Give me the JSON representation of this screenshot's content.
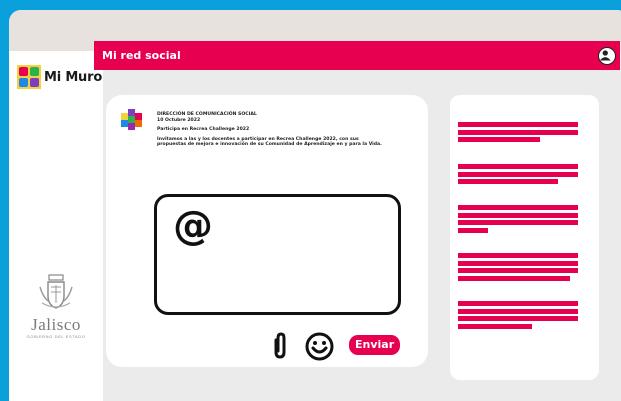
{
  "app": {
    "logo_text": "Mi Muro",
    "header_title": "Mi red social"
  },
  "sidebar": {
    "brand_name": "Jalisco",
    "brand_subtitle": "GOBIERNO DEL ESTADO"
  },
  "post": {
    "author": "DIRECCIÓN DE COMUNICACIÓN SOCIAL",
    "date": "10 Octubre 2022",
    "subject": "Participa en Recrea Challenge 2022",
    "body_line1": "Invitamos a las y los docentes a participar en Recrea Challenge 2022, con sus",
    "body_line2": "propuestas de mejora e innovación de su Comunidad de Aprendizaje en y para la Vida."
  },
  "composer": {
    "mention_symbol": "@",
    "send_label": "Enviar"
  },
  "colors": {
    "accent": "#e6004f",
    "background": "#0aa0dc",
    "panel": "#ebebeb",
    "card": "#ffffff",
    "logo_yellow": "#f3d23f"
  },
  "icons": {
    "attach": "paperclip-icon",
    "emoji": "smiley-face-icon",
    "avatar": "user-avatar-icon",
    "post_author": "colorful-grid-logo-icon"
  }
}
